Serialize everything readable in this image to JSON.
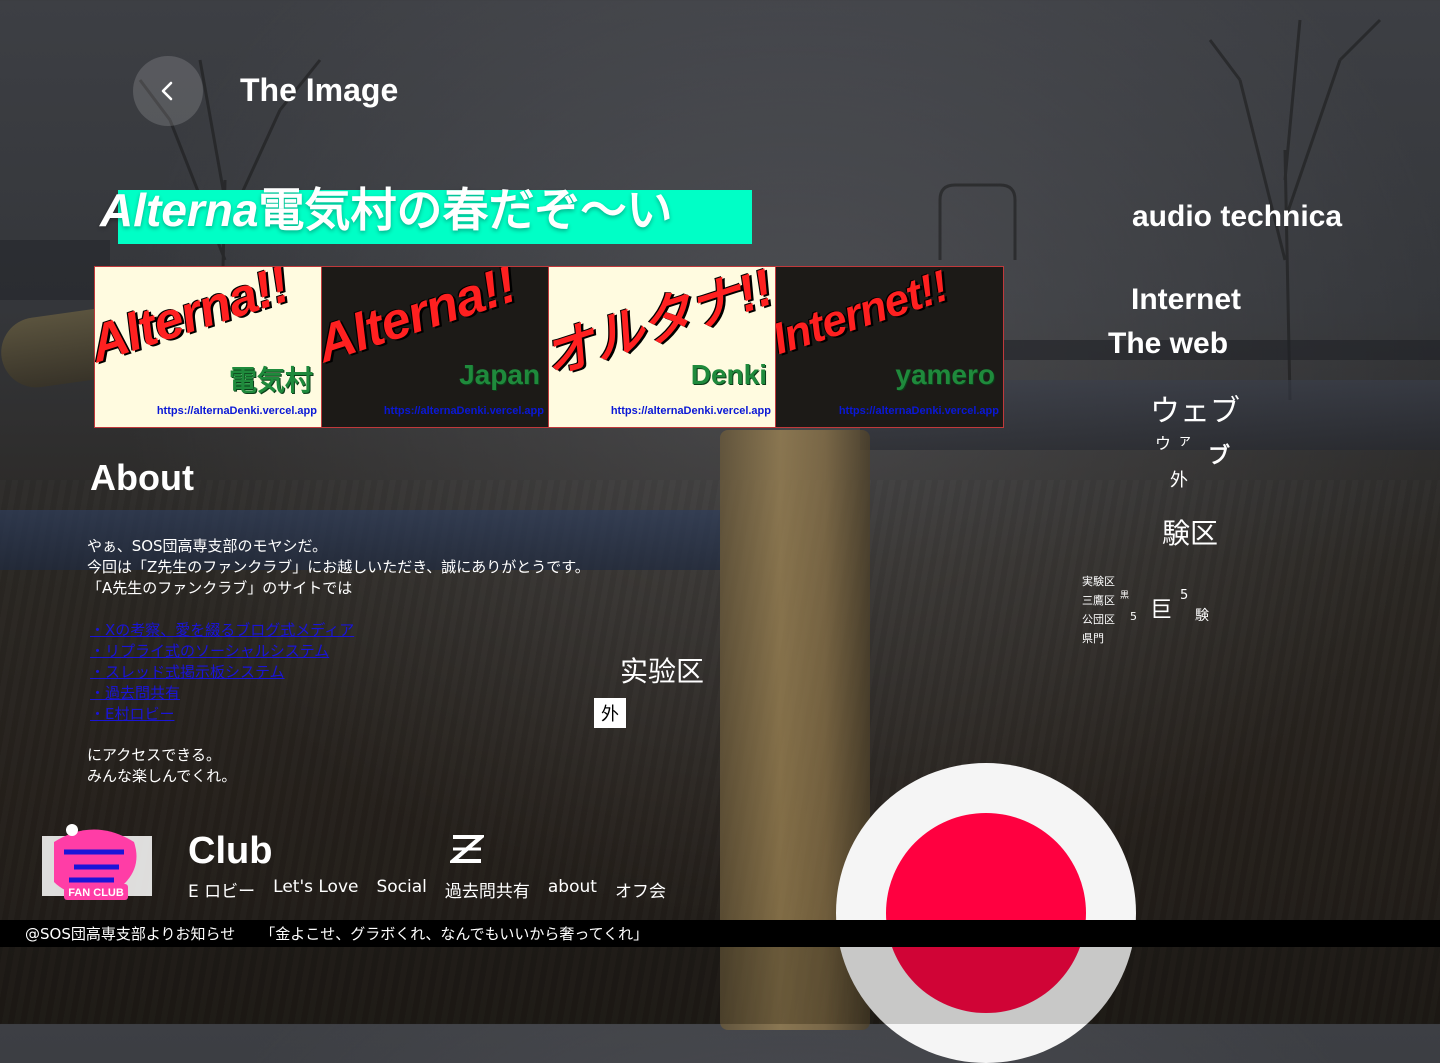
{
  "header": {
    "title": "The Image"
  },
  "hero": {
    "title_latin": "Alterna",
    "title_jp": "電気村の春だぞ〜い"
  },
  "banners": [
    {
      "big": "Alterna!!",
      "sub": "電気村",
      "url": "https://alternaDenki.vercel.app"
    },
    {
      "big": "Alterna!!",
      "sub": "Japan",
      "url": "https://alternaDenki.vercel.app"
    },
    {
      "big": "オルタナ!!",
      "sub": "Denki",
      "url": "https://alternaDenki.vercel.app"
    },
    {
      "big": "Internet!!",
      "sub": "yamero",
      "url": "https://alternaDenki.vercel.app"
    }
  ],
  "about": {
    "heading": "About",
    "intro": [
      "やぁ、SOS団高専支部のモヤシだ。",
      "今回は「Z先生のファンクラブ」にお越しいただき、誠にありがとうです。",
      "「A先生のファンクラブ」のサイトでは"
    ],
    "links": [
      "・Xの考察、愛を綴るブログ式メディア",
      "・リプライ式のソーシャルシステム",
      "・スレッド式掲示板システム",
      "・過去問共有",
      "・E村ロビー"
    ],
    "outro": [
      "にアクセスできる。",
      "みんな楽しんでくれ。"
    ]
  },
  "experiment": {
    "zone": "实验区",
    "mark": "外"
  },
  "side": {
    "audio": "audio technica",
    "internet": "Internet",
    "web": "The web",
    "webu": "ウェブ",
    "kana1": "ウ",
    "kana2": "ァ",
    "kana3": "ブ",
    "kana4": "外",
    "ku": "験区",
    "small": [
      "実験区",
      "三鷹区",
      "公団区",
      "県門"
    ],
    "bits": [
      "黒",
      "5",
      "巨",
      "5",
      "験"
    ]
  },
  "footer": {
    "logo_text": "FAN CLUB",
    "club": "Club",
    "nav": [
      "E ロビー",
      "Let's Love",
      "Social",
      "過去問共有",
      "about",
      "オフ会"
    ]
  },
  "ticker": {
    "source": "@SOS団高専支部よりお知らせ",
    "message": "「金よこせ、グラボくれ、なんでもいいから奢ってくれ」"
  },
  "colors": {
    "hero_accent": "#00ffc6",
    "circle_outer": "#f5f5f5",
    "circle_inner": "#ff0040",
    "banner_red": "#ff2020",
    "banner_green": "#1f8a3c",
    "link_blue": "#1a14d8"
  }
}
